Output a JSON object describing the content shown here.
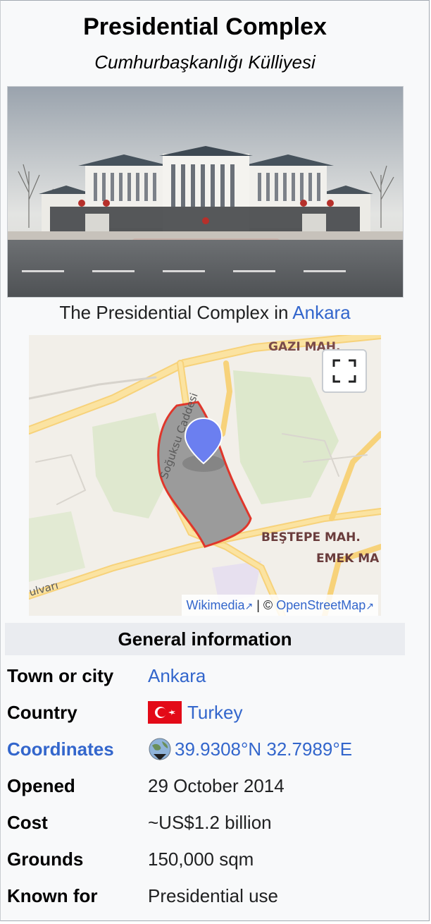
{
  "infobox": {
    "title": "Presidential Complex",
    "native_name": "Cumhurbaşkanlığı Külliyesi",
    "image_caption_prefix": "The Presidential Complex in ",
    "image_caption_link": "Ankara"
  },
  "map": {
    "labels": {
      "gazi": "GAZI MAH.",
      "bestepe": "BEŞTEPE MAH.",
      "emek": "EMEK MA",
      "street": "Soğuksu Caddesi",
      "bulvari": "ulvarı"
    },
    "attribution": {
      "wikimedia": "Wikimedia",
      "separator": " | © ",
      "osm": "OpenStreetMap"
    },
    "icons": {
      "fullscreen": "fullscreen-icon",
      "marker": "map-marker-icon",
      "external": "external-link-icon"
    }
  },
  "general_info": {
    "header": "General information",
    "rows": [
      {
        "label": "Town or city",
        "value": "Ankara"
      },
      {
        "label": "Country",
        "value": "Turkey"
      },
      {
        "label": "Coordinates",
        "value": "39.9308°N 32.7989°E"
      },
      {
        "label": "Opened",
        "value": "29 October 2014"
      },
      {
        "label": "Cost",
        "value": "~US$1.2 billion"
      },
      {
        "label": "Grounds",
        "value": "150,000 sqm"
      },
      {
        "label": "Known for",
        "value": "Presidential use"
      }
    ]
  },
  "colors": {
    "link": "#3366cc",
    "header_bg": "#eaecf0",
    "infobox_bg": "#f8f9fa",
    "boundary": "#e0362b",
    "marker": "#6b7ff0"
  }
}
